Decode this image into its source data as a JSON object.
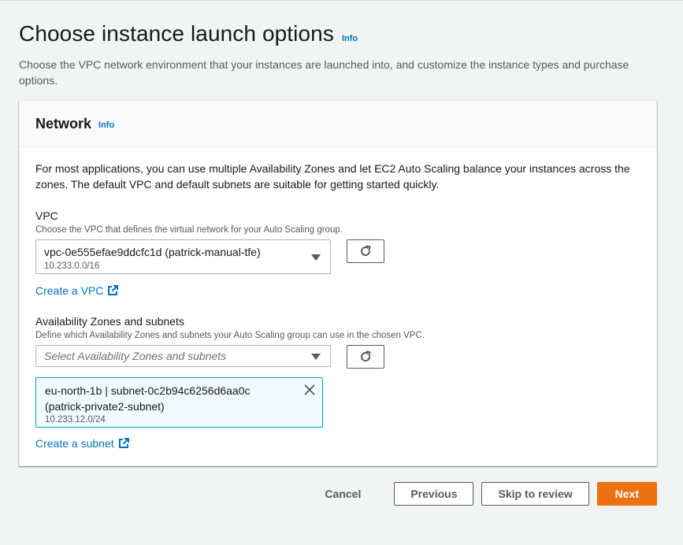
{
  "page": {
    "title": "Choose instance launch options",
    "info_label": "Info",
    "description": "Choose the VPC network environment that your instances are launched into, and customize the instance types and purchase options."
  },
  "network": {
    "title": "Network",
    "info_label": "Info",
    "description": "For most applications, you can use multiple Availability Zones and let EC2 Auto Scaling balance your instances across the zones. The default VPC and default subnets are suitable for getting started quickly.",
    "vpc": {
      "label": "VPC",
      "hint": "Choose the VPC that defines the virtual network for your Auto Scaling group.",
      "selected_value": "vpc-0e555efae9ddcfc1d (patrick-manual-tfe)",
      "selected_cidr": "10.233.0.0/16",
      "create_link": "Create a VPC"
    },
    "subnets": {
      "label": "Availability Zones and subnets",
      "hint": "Define which Availability Zones and subnets your Auto Scaling group can use in the chosen VPC.",
      "placeholder": "Select Availability Zones and subnets",
      "selected": [
        {
          "line1": "eu-north-1b | subnet-0c2b94c6256d6aa0c",
          "line2": "(patrick-private2-subnet)",
          "cidr": "10.233.12.0/24"
        }
      ],
      "create_link": "Create a subnet"
    }
  },
  "actions": {
    "cancel": "Cancel",
    "previous": "Previous",
    "skip": "Skip to review",
    "next": "Next"
  },
  "icons": {
    "refresh": "refresh-icon",
    "external": "external-link-icon",
    "dropdown": "caret-down-icon",
    "dismiss": "close-icon"
  },
  "colors": {
    "link": "#0073bb",
    "primary_button": "#ec7211",
    "token_border": "#00a1c9",
    "token_background": "#f1faff"
  }
}
